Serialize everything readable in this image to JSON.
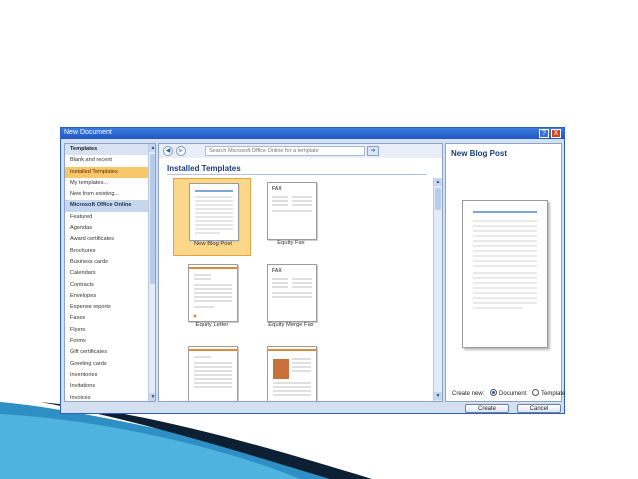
{
  "dialog": {
    "title": "New Document",
    "help_icon": "?",
    "close_icon": "X"
  },
  "left_pane": {
    "items": [
      {
        "label": "Templates",
        "kind": "header"
      },
      {
        "label": "Blank and recent",
        "kind": "item"
      },
      {
        "label": "Installed Templates",
        "kind": "selected"
      },
      {
        "label": "My templates...",
        "kind": "item"
      },
      {
        "label": "New from existing...",
        "kind": "item"
      },
      {
        "label": "Microsoft Office Online",
        "kind": "section"
      },
      {
        "label": "Featured",
        "kind": "item"
      },
      {
        "label": "Agendas",
        "kind": "item"
      },
      {
        "label": "Award certificates",
        "kind": "item"
      },
      {
        "label": "Brochures",
        "kind": "item"
      },
      {
        "label": "Business cards",
        "kind": "item"
      },
      {
        "label": "Calendars",
        "kind": "item"
      },
      {
        "label": "Contracts",
        "kind": "item"
      },
      {
        "label": "Envelopes",
        "kind": "item"
      },
      {
        "label": "Expense reports",
        "kind": "item"
      },
      {
        "label": "Faxes",
        "kind": "item"
      },
      {
        "label": "Flyers",
        "kind": "item"
      },
      {
        "label": "Forms",
        "kind": "item"
      },
      {
        "label": "Gift certificates",
        "kind": "item"
      },
      {
        "label": "Greeting cards",
        "kind": "item"
      },
      {
        "label": "Inventories",
        "kind": "item"
      },
      {
        "label": "Invitations",
        "kind": "item"
      },
      {
        "label": "Invoices",
        "kind": "item"
      }
    ]
  },
  "middle_pane": {
    "search_placeholder": "Search Microsoft Office Online for a template",
    "back_icon": "◀",
    "forward_icon": "▶",
    "go_icon": "➔",
    "section_title": "Installed Templates",
    "templates": [
      {
        "label": "New Blog Post",
        "selected": true
      },
      {
        "label": "Equity Fax",
        "selected": false
      },
      {
        "label": "Equity Letter",
        "selected": false
      },
      {
        "label": "Equity Merge Fax",
        "selected": false
      },
      {
        "label": "",
        "selected": false
      },
      {
        "label": "",
        "selected": false
      }
    ],
    "fax_word": "FAX"
  },
  "right_pane": {
    "title": "New Blog Post",
    "create_new_label": "Create new:",
    "option_document": "Document",
    "option_template": "Template",
    "selected_option": "Document"
  },
  "buttons": {
    "create": "Create",
    "cancel": "Cancel"
  },
  "colors": {
    "title_bar": "#1f56c4",
    "selection": "#f7c76a",
    "slide_swoosh_dark": "#0d1f33",
    "slide_swoosh_light": "#2d8fc4"
  }
}
